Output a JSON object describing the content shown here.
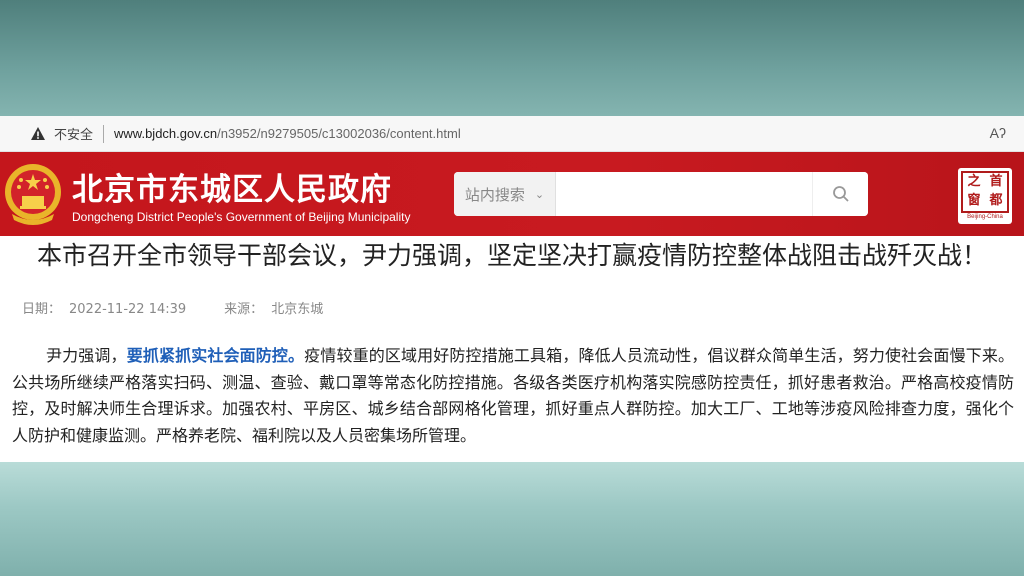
{
  "browser": {
    "security_label": "不安全",
    "url_host": "www.bjdch.gov.cn",
    "url_path": "/n3952/n9279505/c13002036/content.html",
    "read_aloud_label": "Aʔ"
  },
  "site": {
    "title": "北京市东城区人民政府",
    "subtitle": "Dongcheng District People's Government of Beijing Municipality",
    "search_scope": "站内搜索",
    "search_value": "",
    "search_placeholder": "",
    "brand_color": "#c4161c"
  },
  "seal": {
    "char_1": "首",
    "char_2": "之",
    "char_3": "都",
    "char_4": "窗",
    "caption": "Beijing-China"
  },
  "article": {
    "title": "本市召开全市领导干部会议，尹力强调，坚定坚决打赢疫情防控整体战阻击战歼灭战！",
    "date_label": "日期：",
    "date_value": "2022-11-22 14:39",
    "source_label": "来源：",
    "source_value": "北京东城",
    "body_lead": "尹力强调，",
    "body_highlight": "要抓紧抓实社会面防控。",
    "body_rest": "疫情较重的区域用好防控措施工具箱，降低人员流动性，倡议群众简单生活，努力使社会面慢下来。公共场所继续严格落实扫码、测温、查验、戴口罩等常态化防控措施。各级各类医疗机构落实院感防控责任，抓好患者救治。严格高校疫情防控，及时解决师生合理诉求。加强农村、平房区、城乡结合部网格化管理，抓好重点人群防控。加大工厂、工地等涉疫风险排查力度，强化个人防护和健康监测。严格养老院、福利院以及人员密集场所管理。",
    "highlight_color": "#1f5fb8"
  }
}
